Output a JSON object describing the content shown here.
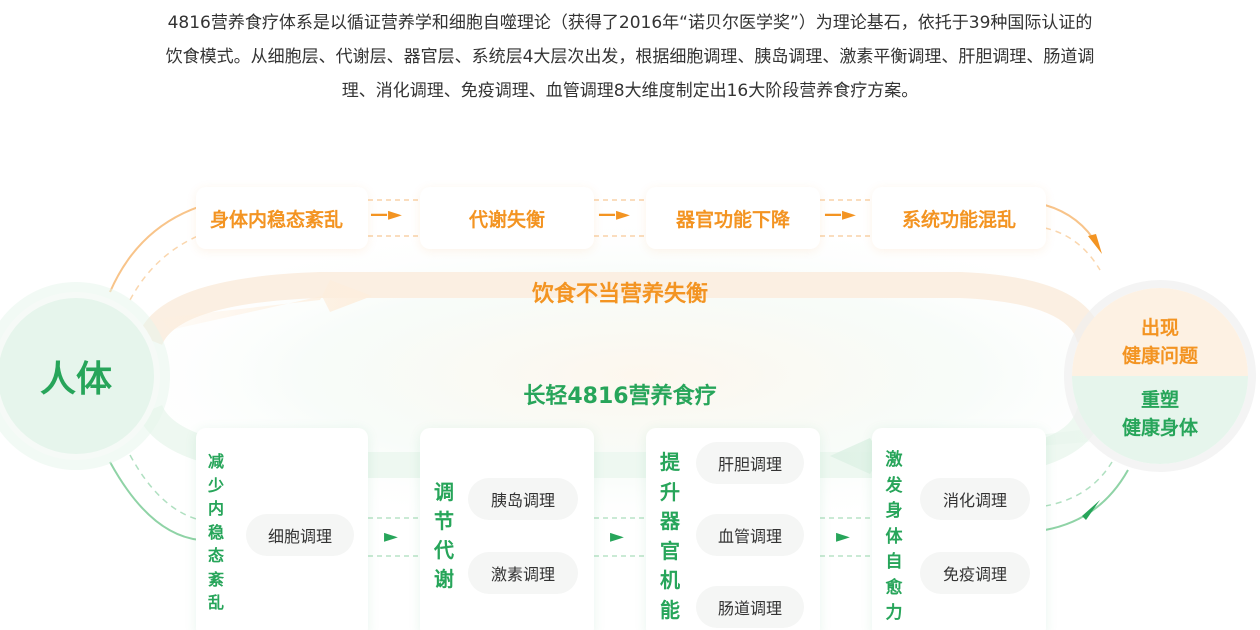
{
  "intro": {
    "line1": "4816营养食疗体系是以循证营养学和细胞自噬理论（获得了2016年“诺贝尔医学奖”）为理论基石，依托于39种国际认证的",
    "line2": "饮食模式。从细胞层、代谢层、器官层、系统层4大层次出发，根据细胞调理、胰岛调理、激素平衡调理、肝胆调理、肠道调",
    "line3": "理、消化调理、免疫调理、血管调理8大维度制定出16大阶段营养食疗方案。"
  },
  "top_flow": [
    {
      "label": "身体内稳态紊乱"
    },
    {
      "label": "代谢失衡"
    },
    {
      "label": "器官功能下降"
    },
    {
      "label": "系统功能混乱"
    }
  ],
  "top_arrow": "—►",
  "middle": {
    "problem_title": "饮食不当营养失衡",
    "solution_title": "长轻4816营养食疗"
  },
  "human": {
    "label": "人体"
  },
  "outcome": {
    "problem_line1": "出现",
    "problem_line2": "健康问题",
    "result_line1": "重塑",
    "result_line2": "健康身体"
  },
  "bottom_flow": [
    {
      "title": [
        "减",
        "少",
        "内",
        "稳",
        "态",
        "紊",
        "乱"
      ],
      "items": [
        "细胞调理"
      ]
    },
    {
      "title": [
        "调",
        "节",
        "代",
        "谢"
      ],
      "items": [
        "胰岛调理",
        "激素调理"
      ]
    },
    {
      "title": [
        "提",
        "升",
        "器",
        "官",
        "机",
        "能"
      ],
      "items": [
        "肝胆调理",
        "血管调理",
        "肠道调理"
      ]
    },
    {
      "title": [
        "激",
        "发",
        "身",
        "体",
        "自",
        "愈",
        "力"
      ],
      "items": [
        "消化调理",
        "免疫调理"
      ]
    }
  ],
  "bottom_arrow": "►",
  "colors": {
    "orange": "#f39422",
    "green": "#27a55a",
    "green_light": "#e6f5ec",
    "orange_light": "#fdf1e3"
  }
}
